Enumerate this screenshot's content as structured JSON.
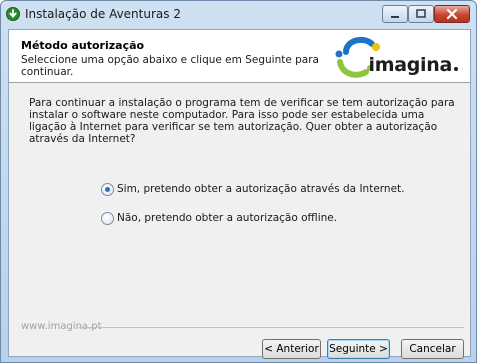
{
  "window": {
    "title": "Instalação de Aventuras 2"
  },
  "header": {
    "title": "Método autorização",
    "subtitle": "Seleccione uma opção abaixo e clique em Seguinte para continuar.",
    "logo_text": "imagina"
  },
  "body": {
    "intro": "Para continuar a instalação o programa tem de verificar se tem autorização para instalar o software neste computador. Para isso pode ser estabelecida uma ligação à Internet para verificar se tem autorização. Quer obter a autorização através da Internet?",
    "options": [
      {
        "label": "Sim, pretendo obter a autorização através da Internet.",
        "selected": true
      },
      {
        "label": "Não, pretendo obter a autorização offline.",
        "selected": false
      }
    ]
  },
  "footer": {
    "brand_url": "www.imagina.pt",
    "buttons": {
      "back": "< Anterior",
      "next": "Seguinte >",
      "cancel": "Cancelar"
    }
  },
  "colors": {
    "accent": "#2f6fc1",
    "logo_blue": "#1e73c8",
    "logo_green": "#8cc63f",
    "logo_yellow": "#f2c200",
    "close_red": "#c7452f"
  },
  "icons": {
    "app": "download-arrow-icon",
    "minimize": "minimize-icon",
    "maximize": "maximize-icon",
    "close": "close-icon"
  }
}
